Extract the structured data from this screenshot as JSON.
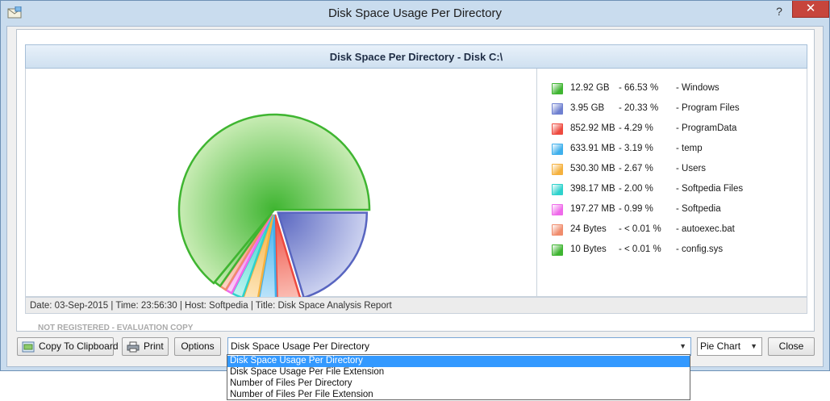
{
  "window": {
    "title": "Disk Space Usage Per Directory",
    "help_glyph": "?",
    "close_glyph": "✕"
  },
  "report": {
    "title": "Disk Space Per Directory - Disk C:\\",
    "watermark_note": "NOT REGISTERED - EVALUATION COPY",
    "footer": "Date: 03-Sep-2015 | Time: 23:56:30 | Host: Softpedia | Title: Disk Space Analysis Report"
  },
  "legend": [
    {
      "size": "12.92 GB",
      "pct": "-  66.53 %",
      "name": "-  Windows",
      "color": "#3fb531"
    },
    {
      "size": "3.95 GB",
      "pct": "-  20.33 %",
      "name": "-  Program Files",
      "color": "#6f80d0"
    },
    {
      "size": "852.92 MB",
      "pct": "-  4.29 %",
      "name": "-  ProgramData",
      "color": "#ee4a3f"
    },
    {
      "size": "633.91 MB",
      "pct": "-  3.19 %",
      "name": "-  temp",
      "color": "#3fb0ec"
    },
    {
      "size": "530.30 MB",
      "pct": "-  2.67 %",
      "name": "-  Users",
      "color": "#f5b13e"
    },
    {
      "size": "398.17 MB",
      "pct": "-  2.00 %",
      "name": "-  Softpedia Files",
      "color": "#2ed2cc"
    },
    {
      "size": "197.27 MB",
      "pct": "-  0.99 %",
      "name": "-  Softpedia",
      "color": "#ef6aea"
    },
    {
      "size": "24 Bytes",
      "pct": "-  < 0.01 %",
      "name": "-  autoexec.bat",
      "color": "#f08c6c"
    },
    {
      "size": "10 Bytes",
      "pct": "-  < 0.01 %",
      "name": "-  config.sys",
      "color": "#3fb531"
    }
  ],
  "chart_data": {
    "type": "pie",
    "slices": [
      {
        "label": "Windows",
        "value": 66.53,
        "color": "#3fb531",
        "light": "#c8ecb4"
      },
      {
        "label": "Program Files",
        "value": 20.33,
        "color": "#5865c0",
        "light": "#ccd2f0"
      },
      {
        "label": "ProgramData",
        "value": 4.29,
        "color": "#ee4a3f",
        "light": "#fbc2b8"
      },
      {
        "label": "temp",
        "value": 3.19,
        "color": "#3fb0ec",
        "light": "#c2e6fb"
      },
      {
        "label": "Users",
        "value": 2.67,
        "color": "#f5b13e",
        "light": "#fde7bf"
      },
      {
        "label": "Softpedia Files",
        "value": 2.0,
        "color": "#2ed2cc",
        "light": "#c0f3f0"
      },
      {
        "label": "Softpedia",
        "value": 0.99,
        "color": "#ef6aea",
        "light": "#fbd0f8"
      },
      {
        "label": "autoexec.bat",
        "value": 0.01,
        "color": "#f08c6c",
        "light": "#fbd5c6"
      },
      {
        "label": "config.sys",
        "value": 0.01,
        "color": "#3fb531",
        "light": "#c8ecb4"
      }
    ]
  },
  "toolbar": {
    "copy_label": "Copy To Clipboard",
    "print_label": "Print",
    "options_label": "Options",
    "report_combo_value": "Disk Space Usage Per Directory",
    "chart_combo_value": "Pie Chart",
    "close_label": "Close"
  },
  "dropdown": {
    "options": [
      "Disk Space Usage Per Directory",
      "Disk Space Usage Per File Extension",
      "Number of Files Per Directory",
      "Number of Files Per File Extension"
    ],
    "selected_index": 0
  },
  "icons": {
    "app": "app-envelope-icon",
    "copy": "clipboard-icon",
    "print": "printer-icon",
    "dropdown": "chevron-down-icon"
  }
}
